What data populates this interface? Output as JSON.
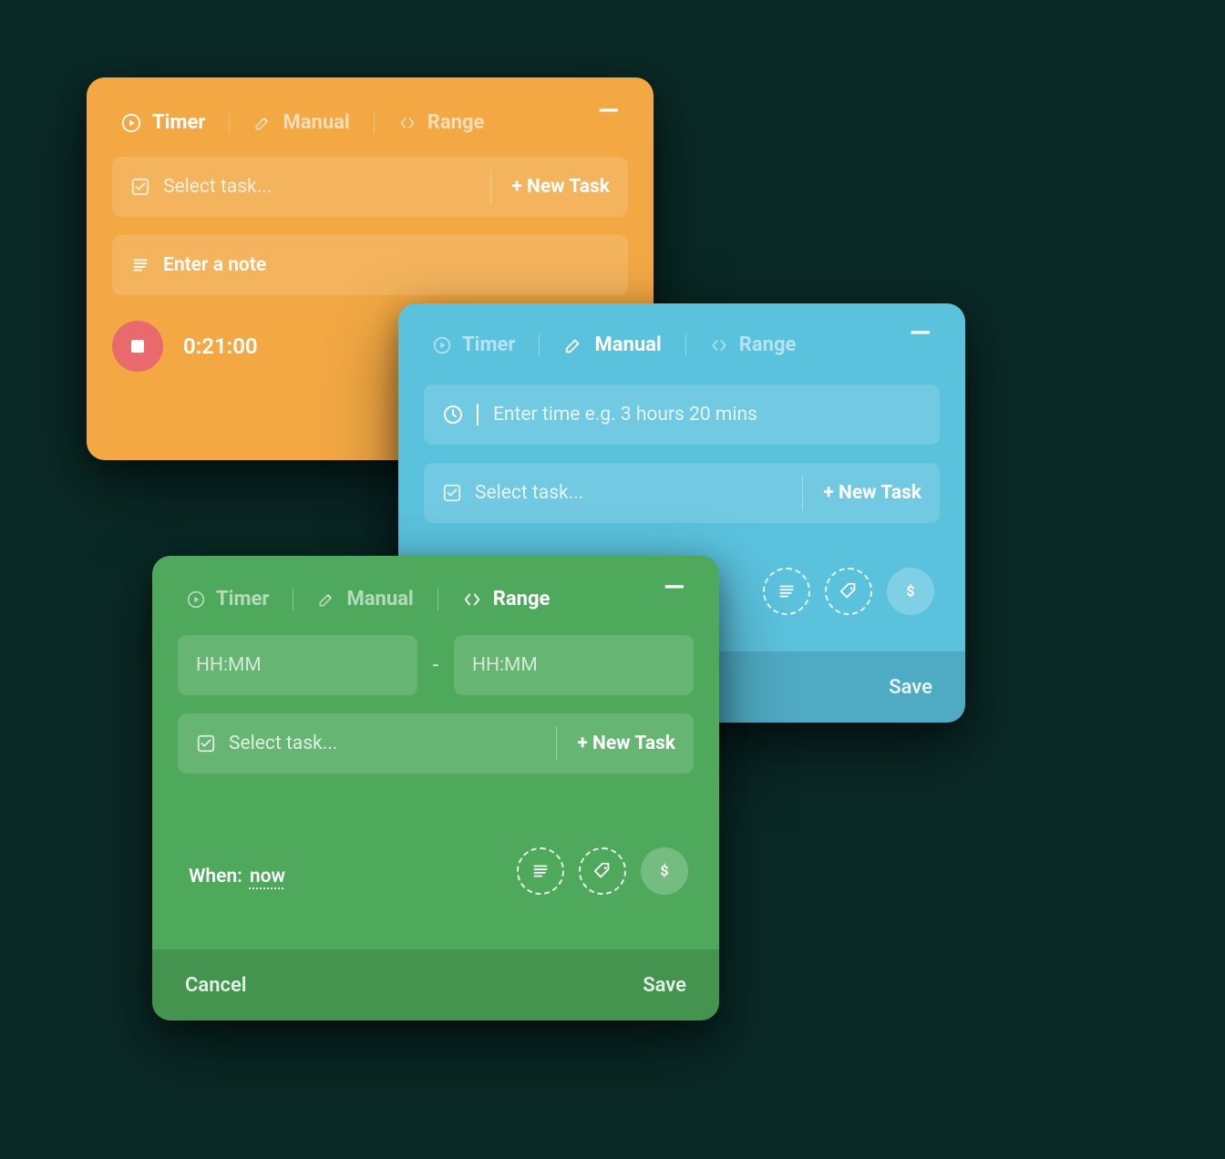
{
  "tabs": {
    "timer": "Timer",
    "manual": "Manual",
    "range": "Range"
  },
  "common": {
    "select_task_placeholder": "Select task...",
    "new_task_label": "+ New Task",
    "cancel": "Cancel",
    "save": "Save",
    "minimize": "—"
  },
  "orange": {
    "active_tab": "timer",
    "note_placeholder": "Enter a note",
    "elapsed": "0:21:00"
  },
  "blue": {
    "active_tab": "manual",
    "time_placeholder": "Enter time e.g. 3 hours 20 mins",
    "actions": {
      "note_icon": "list-icon",
      "tag_icon": "tag-icon",
      "billable_icon": "dollar-icon"
    }
  },
  "green": {
    "active_tab": "range",
    "start_placeholder": "HH:MM",
    "end_placeholder": "HH:MM",
    "range_separator": "-",
    "when_label": "When:",
    "when_value": "now",
    "actions": {
      "note_icon": "list-icon",
      "tag_icon": "tag-icon",
      "billable_icon": "dollar-icon"
    }
  },
  "colors": {
    "orange": "#f3a843",
    "blue": "#5bc2de",
    "green": "#4ea95c",
    "stop": "#e96a6c"
  }
}
